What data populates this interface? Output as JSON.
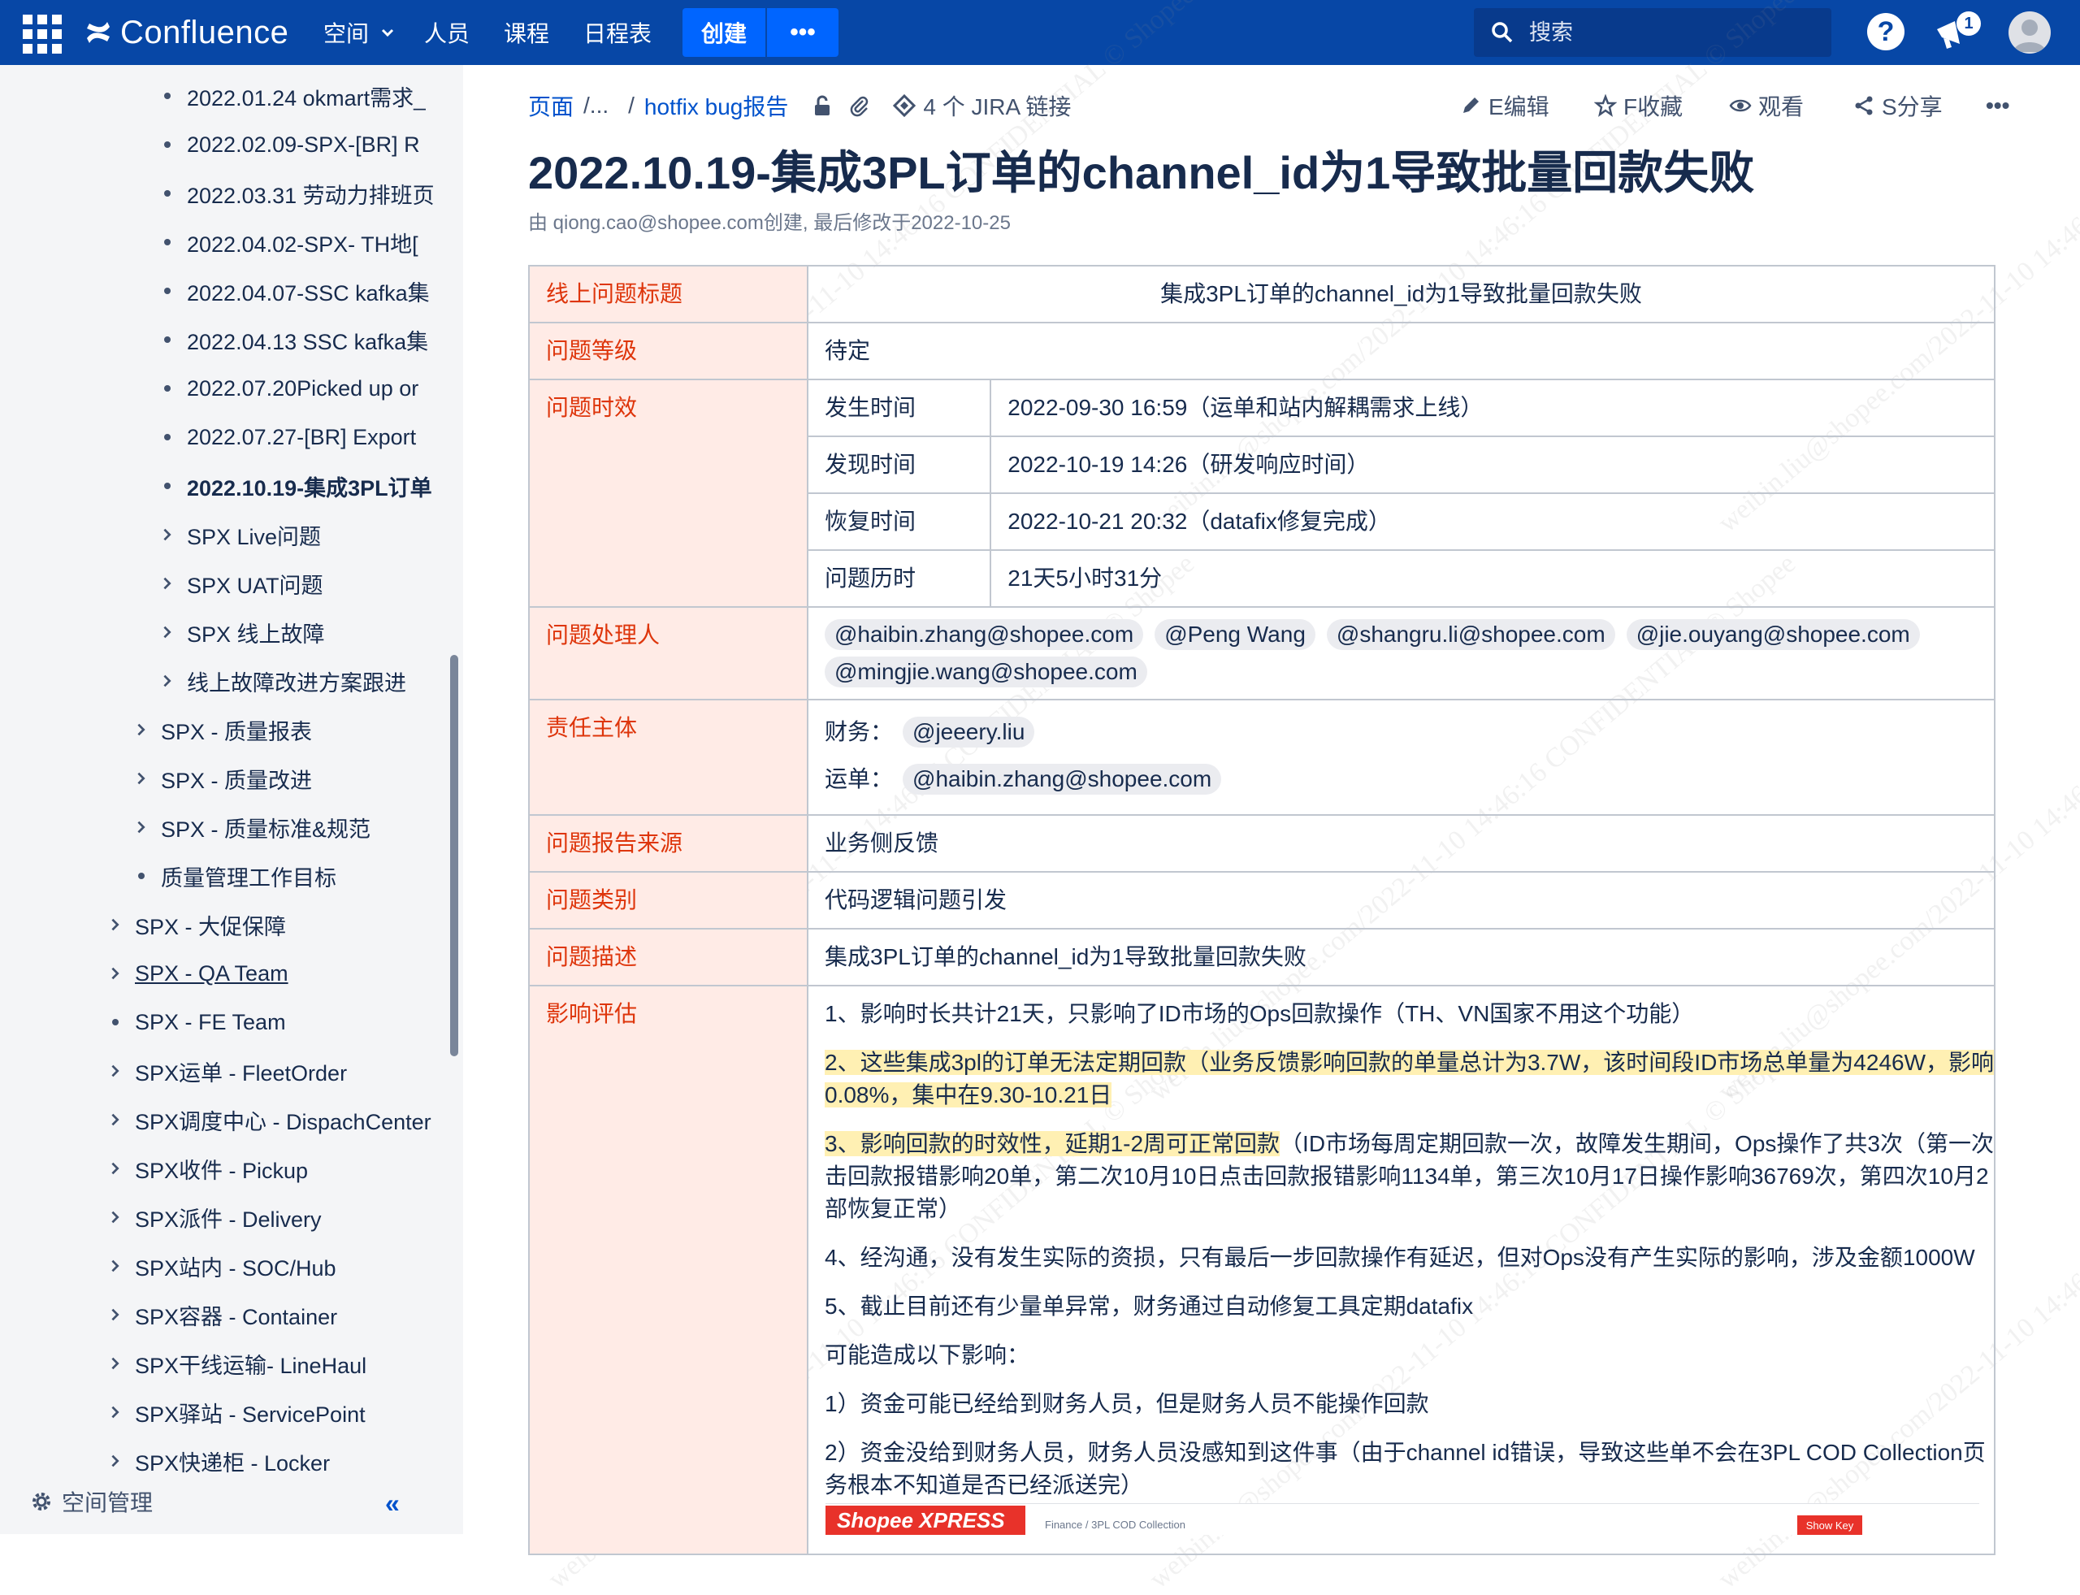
{
  "topnav": {
    "logo": "Confluence",
    "items": [
      "空间",
      "人员",
      "课程",
      "日程表"
    ],
    "create": "创建",
    "more": "•••",
    "search_placeholder": "搜索",
    "help": "?",
    "notifications_count": "1"
  },
  "sidebar": {
    "items": [
      {
        "label": "2022.01.24 okmart需求_",
        "type": "bullet"
      },
      {
        "label": "2022.02.09-SPX-[BR] R",
        "type": "bullet"
      },
      {
        "label": "2022.03.31 劳动力排班页",
        "type": "bullet"
      },
      {
        "label": "2022.04.02-SPX- TH地[",
        "type": "bullet"
      },
      {
        "label": "2022.04.07-SSC kafka集",
        "type": "bullet"
      },
      {
        "label": "2022.04.13 SSC kafka集",
        "type": "bullet"
      },
      {
        "label": "2022.07.20Picked up or",
        "type": "bullet"
      },
      {
        "label": "2022.07.27-[BR] Export",
        "type": "bullet"
      },
      {
        "label": "2022.10.19-集成3PL订单",
        "type": "bullet",
        "current": true
      },
      {
        "label": "SPX Live问题",
        "type": "chevron"
      },
      {
        "label": "SPX UAT问题",
        "type": "chevron"
      },
      {
        "label": "SPX 线上故障",
        "type": "chevron"
      },
      {
        "label": "线上故障改进方案跟进",
        "type": "chevron"
      },
      {
        "label": "SPX - 质量报表",
        "type": "chevron"
      },
      {
        "label": "SPX - 质量改进",
        "type": "chevron"
      },
      {
        "label": "SPX - 质量标准&规范",
        "type": "chevron"
      },
      {
        "label": "质量管理工作目标",
        "type": "bullet"
      },
      {
        "label": "SPX - 大促保障",
        "type": "chevron"
      },
      {
        "label": "SPX - QA Team",
        "type": "chevron",
        "linked": true
      },
      {
        "label": "SPX - FE Team",
        "type": "bullet"
      },
      {
        "label": "SPX运单 - FleetOrder",
        "type": "chevron"
      },
      {
        "label": "SPX调度中心 - DispachCenter",
        "type": "chevron"
      },
      {
        "label": "SPX收件 - Pickup",
        "type": "chevron"
      },
      {
        "label": "SPX派件 - Delivery",
        "type": "chevron"
      },
      {
        "label": "SPX站内 - SOC/Hub",
        "type": "chevron"
      },
      {
        "label": "SPX容器 - Container",
        "type": "chevron"
      },
      {
        "label": "SPX干线运输- LineHaul",
        "type": "chevron"
      },
      {
        "label": "SPX驿站 - ServicePoint",
        "type": "chevron"
      },
      {
        "label": "SPX快递柜 - Locker",
        "type": "chevron"
      }
    ],
    "space_admin": "空间管理",
    "collapse": "«"
  },
  "breadcrumb": {
    "page": "页面",
    "ellipsis": "/...",
    "sep": "/",
    "parent": "hotfix bug报告",
    "jira": "4 个 JIRA 链接"
  },
  "actions": {
    "edit": "E编辑",
    "favorite": "F收藏",
    "watch": "观看",
    "share": "S分享",
    "more": "•••"
  },
  "page": {
    "title": "2022.10.19-集成3PL订单的channel_id为1导致批量回款失败",
    "byline": "由 qiong.cao@shopee.com创建, 最后修改于2022-10-25"
  },
  "table": {
    "title_label": "线上问题标题",
    "title_value": "集成3PL订单的channel_id为1导致批量回款失败",
    "level_label": "问题等级",
    "level_value": "待定",
    "time_label": "问题时效",
    "times": [
      {
        "k": "发生时间",
        "v": "2022-09-30 16:59（运单和站内解耦需求上线）"
      },
      {
        "k": "发现时间",
        "v": "2022-10-19 14:26（研发响应时间）"
      },
      {
        "k": "恢复时间",
        "v": "2022-10-21 20:32（datafix修复完成）"
      },
      {
        "k": "问题历时",
        "v": "21天5小时31分"
      }
    ],
    "handler_label": "问题处理人",
    "handlers": [
      "@haibin.zhang@shopee.com",
      "@Peng Wang",
      "@shangru.li@shopee.com",
      "@jie.ouyang@shopee.com",
      "@mingjie.wang@shopee.com"
    ],
    "owner_label": "责任主体",
    "owner_finance_k": "财务：",
    "owner_finance_v": "@jeeery.liu",
    "owner_waybill_k": "运单：",
    "owner_waybill_v": "@haibin.zhang@shopee.com",
    "source_label": "问题报告来源",
    "source_value": "业务侧反馈",
    "category_label": "问题类别",
    "category_value": "代码逻辑问题引发",
    "desc_label": "问题描述",
    "desc_value": "集成3PL订单的channel_id为1导致批量回款失败",
    "impact_label": "影响评估",
    "impact": {
      "p1": "1、影响时长共计21天，只影响了ID市场的Ops回款操作（TH、VN国家不用这个功能）",
      "p2a": "2、这些集成3pl的订单无法定期回款（业务反馈影响回款的单量总计为3.7W，该时间段ID市场总单量为4246W，影响",
      "p2b": "0.08%，集中在9.30-10.21日",
      "p3a_hl": "3、影响回款的时效性，延期1-2周可正常回款",
      "p3a": "（ID市场每周定期回款一次，故障发生期间，Ops操作了共3次（第一次",
      "p3b": "击回款报错影响20单，第二次10月10日点击回款报错影响1134单，第三次10月17日操作影响36769次，第四次10月2",
      "p3c": "部恢复正常）",
      "p4": "4、经沟通，没有发生实际的资损，只有最后一步回款操作有延迟，但对Ops没有产生实际的影响，涉及金额1000W",
      "p5": "5、截止目前还有少量单异常，财务通过自动修复工具定期datafix",
      "p6": "可能造成以下影响：",
      "p7": "1）资金可能已经给到财务人员，但是财务人员不能操作回款",
      "p8a": "2）资金没给到财务人员，财务人员没感知到这件事（由于channel id错误，导致这些单不会在3PL COD Collection页",
      "p8b": "务根本不知道是否已经派送完）"
    }
  },
  "screenshot": {
    "logo": "Shopee XPRESS",
    "crumb": "Finance  /  3PL COD Collection",
    "btn": "Show Key"
  },
  "watermark": "weibin.liu@shopee.com/2022-11-10 14:46:16 CONFIDENTIAL © Shopee",
  "colors": {
    "topbar": "#0747a6",
    "create": "#0065ff",
    "header_cell_bg": "#ffebe6",
    "header_cell_text": "#de350b",
    "link": "#0052cc",
    "highlight": "#fff0b3"
  }
}
